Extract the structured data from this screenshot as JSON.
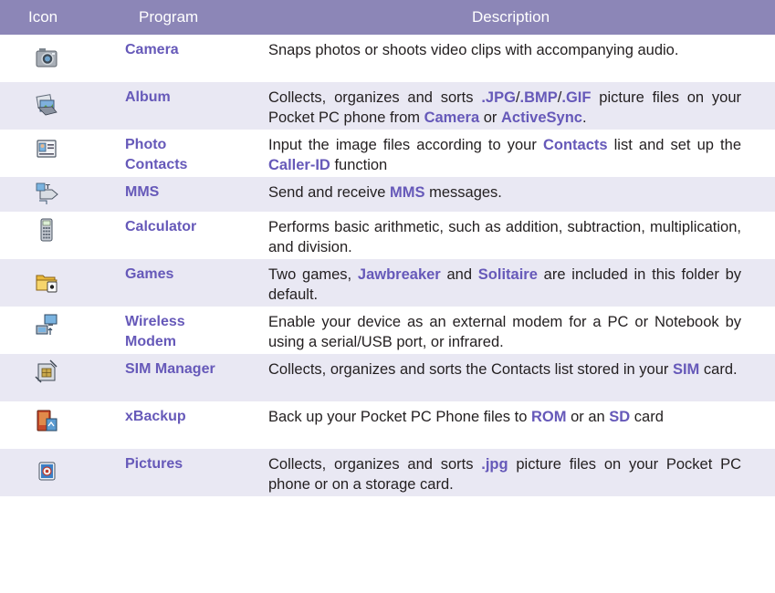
{
  "header": {
    "icon": "Icon",
    "program": "Program",
    "description": "Description"
  },
  "colors": {
    "header_bg": "#8c86b7",
    "row_shade": "#e9e8f3",
    "keyword": "#6659b9"
  },
  "rows": [
    {
      "icon": "camera-icon",
      "program": "Camera",
      "desc": [
        "Snaps photos or shoots video clips with accompanying audio."
      ]
    },
    {
      "icon": "album-icon",
      "program": "Album",
      "desc": [
        "Collects, organizes and sorts ",
        ".JPG",
        "/",
        ".BMP",
        "/",
        ".GIF",
        " picture files on your Pocket PC phone from ",
        "Camera",
        " or ",
        "ActiveSync",
        "."
      ]
    },
    {
      "icon": "photo-contacts-icon",
      "program": "Photo Contacts",
      "desc": [
        "Input the image files according to your ",
        "Contacts",
        " list and set up the ",
        "Caller-ID",
        " function"
      ]
    },
    {
      "icon": "mms-icon",
      "program": "MMS",
      "desc": [
        "Send and receive ",
        "MMS",
        " messages."
      ]
    },
    {
      "icon": "calculator-icon",
      "program": "Calculator",
      "desc": [
        "Performs basic arithmetic, such as addition, subtraction, multiplication, and division."
      ]
    },
    {
      "icon": "games-folder-icon",
      "program": "Games",
      "desc": [
        "Two games, ",
        "Jawbreaker",
        " and ",
        "Solitaire",
        " are included in this folder by default."
      ]
    },
    {
      "icon": "wireless-modem-icon",
      "program": "Wireless Modem",
      "desc": [
        "Enable your device as an external modem for a PC or Notebook by using a serial/USB port, or infrared."
      ]
    },
    {
      "icon": "sim-manager-icon",
      "program": "SIM Manager",
      "desc": [
        "Collects, organizes and sorts the Contacts list stored in your ",
        "SIM",
        " card."
      ]
    },
    {
      "icon": "xbackup-icon",
      "program": "xBackup",
      "desc": [
        "Back up your Pocket PC Phone files to ",
        "ROM",
        " or an ",
        "SD",
        " card"
      ]
    },
    {
      "icon": "pictures-icon",
      "program": "Pictures",
      "desc": [
        "Collects, organizes and sorts ",
        ".jpg",
        " picture files on your Pocket PC phone or on a storage card."
      ]
    }
  ]
}
